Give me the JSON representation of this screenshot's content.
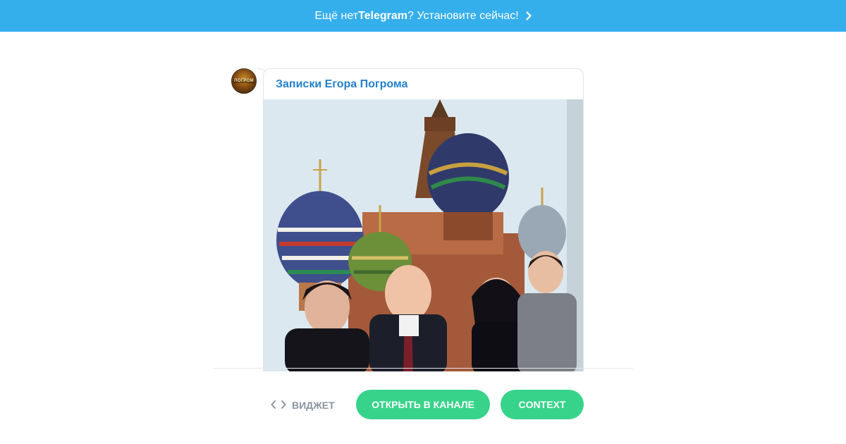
{
  "banner": {
    "prefix": "Ещё нет ",
    "brand": "Telegram",
    "suffix": "? Установите сейчас!",
    "icon": "chevron-right-icon",
    "color": "#35aeec"
  },
  "post": {
    "avatar_text": "ПОГРОМ",
    "channel_name": "Записки Егора Погрома",
    "channel_color": "#2481cc"
  },
  "footer": {
    "widget_icon": "code-brackets-icon",
    "widget_label": "ВИДЖЕТ",
    "open_button": "ОТКРЫТЬ В КАНАЛЕ",
    "context_button": "CONTEXT",
    "button_color": "#38d38a"
  }
}
